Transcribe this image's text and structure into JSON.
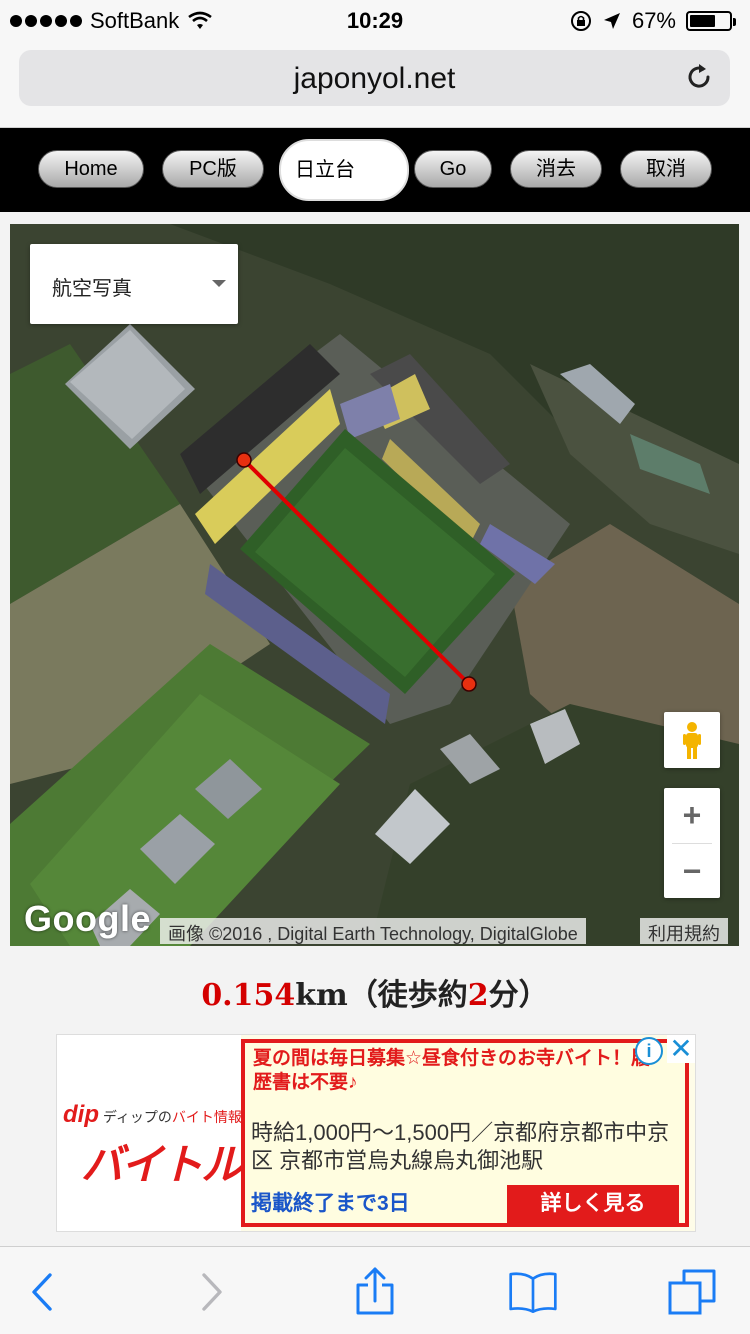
{
  "status_bar": {
    "carrier": "SoftBank",
    "time": "10:29",
    "battery": "67%",
    "battery_level": 0.67,
    "icons": [
      "signal-dots-icon",
      "wifi-icon",
      "rotation-lock-icon",
      "location-arrow-icon",
      "battery-icon"
    ]
  },
  "browser": {
    "url": "japonyol.net",
    "reload_icon": "reload-icon"
  },
  "toolbar": {
    "home": "Home",
    "pc": "PC版",
    "search_value": "日立台",
    "go": "Go",
    "delete": "消去",
    "cancel": "取消"
  },
  "map": {
    "type_selected": "航空写真",
    "google": "Google",
    "attribution": "画像 ©2016 , Digital Earth Technology, DigitalGlobe",
    "terms": "利用規約",
    "zoom_in": "+",
    "zoom_out": "−",
    "colors": {
      "route": "#e00000",
      "marker": "#e83010"
    }
  },
  "distance": {
    "value": "0.154",
    "unit": "km（徒歩約",
    "minutes": "2",
    "suffix": "分）"
  },
  "ad": {
    "brand_line": "ディップの",
    "brand_line2": "バイト情報",
    "brand_logo": "dip",
    "brand_name": "バイトル",
    "headline": "夏の間は毎日募集☆昼食付きのお寺バイト！履歴書は不要♪",
    "body": "時給1,000円〜1,500円／京都府京都市中京区 京都市営烏丸線烏丸御池駅",
    "until": "掲載終了まで3日",
    "cta": "詳しく見る",
    "info": "i",
    "close": "✕"
  },
  "bottom_bar": {
    "icons": [
      "back-icon",
      "forward-icon",
      "share-icon",
      "bookmarks-icon",
      "tabs-icon"
    ]
  }
}
